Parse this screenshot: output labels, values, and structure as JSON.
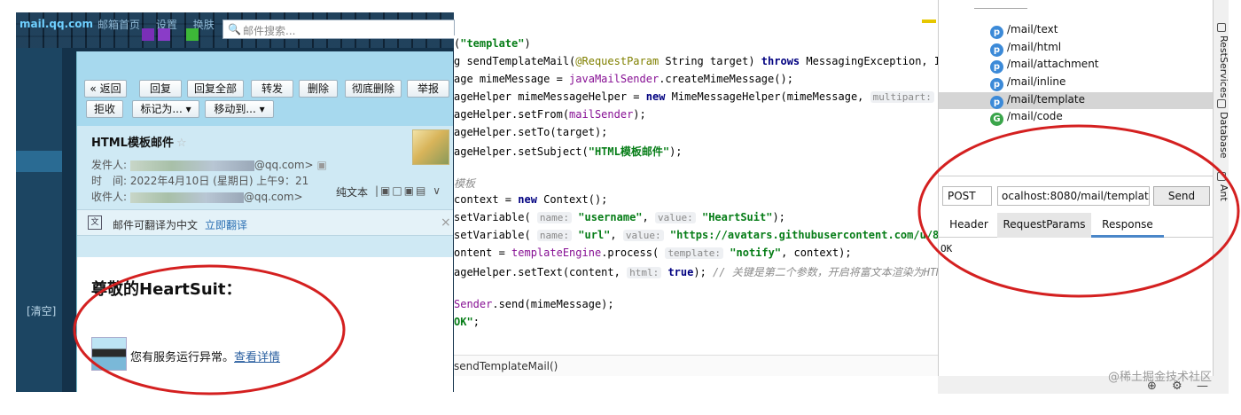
{
  "mail_chrome": {
    "logo": "mail.qq.com",
    "nav": [
      "邮箱首页",
      "设置",
      "换肤"
    ],
    "search_placeholder": "邮件搜索...",
    "clear_label": "[清空]"
  },
  "mail": {
    "toolbar_row1": [
      "« 返回",
      "回复",
      "回复全部",
      "转发",
      "删除",
      "彻底删除",
      "举报"
    ],
    "toolbar_row2": [
      "拒收",
      "标记为... ▾",
      "移动到... ▾"
    ],
    "subject": "HTML模板邮件",
    "from_label": "发件人:",
    "from_suffix": "@qq.com>",
    "time_label": "时　间:",
    "time_value": "2022年4月10日 (星期日) 上午9：21",
    "to_label": "收件人:",
    "to_suffix": "@qq.com>",
    "plain_text": "纯文本",
    "translate_text": "邮件可翻译为中文",
    "translate_link": "立即翻译",
    "greeting": "尊敬的HeartSuit：",
    "notice_text": "您有服务运行异常。",
    "notice_link": "查看详情"
  },
  "code": {
    "breadcrumb": "sendTemplateMail()"
  },
  "rest": {
    "endpoints": [
      {
        "method_badge": "p",
        "path": "/mail/text"
      },
      {
        "method_badge": "p",
        "path": "/mail/html"
      },
      {
        "method_badge": "p",
        "path": "/mail/attachment"
      },
      {
        "method_badge": "p",
        "path": "/mail/inline"
      },
      {
        "method_badge": "p",
        "path": "/mail/template",
        "selected": true
      },
      {
        "method_badge": "G",
        "path": "/mail/code"
      }
    ],
    "method": "POST",
    "url": "ocalhost:8080/mail/template",
    "send_label": "Send",
    "tabs": [
      "Header",
      "RequestParams",
      "Response"
    ],
    "active_tab": "RequestParams",
    "response_body": "OK"
  },
  "tool_strip": {
    "labels": [
      "RestServices",
      "Database",
      "Ant"
    ]
  },
  "watermark": "@稀土掘金技术社区",
  "colors": {
    "annotation": "#d42020",
    "rest_selection": "#d5d5d5",
    "response_tab_underline": "#4a86c8",
    "qq_toolbar": "#a7d9ee"
  }
}
